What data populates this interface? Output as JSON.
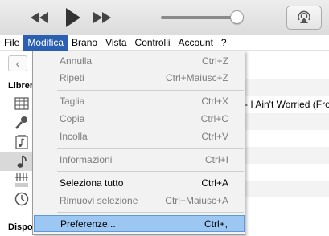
{
  "menubar": {
    "items": [
      "File",
      "Modifica",
      "Brano",
      "Vista",
      "Controlli",
      "Account",
      "?"
    ],
    "active": "Modifica"
  },
  "sidebar": {
    "section_library": "Libreria",
    "section_devices": "Dispositivi"
  },
  "content": {
    "track_title": "- I Ain't Worried (Fro"
  },
  "dropdown": {
    "items": [
      {
        "label": "Annulla",
        "shortcut": "Ctrl+Z",
        "enabled": false
      },
      {
        "label": "Ripeti",
        "shortcut": "Ctrl+Maiusc+Z",
        "enabled": false
      },
      {
        "label": "Taglia",
        "shortcut": "Ctrl+X",
        "enabled": false
      },
      {
        "label": "Copia",
        "shortcut": "Ctrl+C",
        "enabled": false
      },
      {
        "label": "Incolla",
        "shortcut": "Ctrl+V",
        "enabled": false
      },
      {
        "label": "Informazioni",
        "shortcut": "Ctrl+I",
        "enabled": false
      },
      {
        "label": "Seleziona tutto",
        "shortcut": "Ctrl+A",
        "enabled": true
      },
      {
        "label": "Rimuovi selezione",
        "shortcut": "Ctrl+Maiusc+A",
        "enabled": false
      },
      {
        "label": "Preferenze...",
        "shortcut": "Ctrl+,",
        "enabled": true,
        "highlighted": true
      }
    ]
  },
  "icons": {
    "toolbar": [
      "previous-icon",
      "play-icon",
      "next-icon",
      "airplay-icon"
    ],
    "sidebar": [
      "grid-icon",
      "microphone-icon",
      "music-note-list-icon",
      "music-note-icon",
      "composer-icon",
      "clock-icon"
    ]
  },
  "colors": {
    "menu_active": "#2a5fb2",
    "menu_highlight": "#9cc7f3"
  }
}
